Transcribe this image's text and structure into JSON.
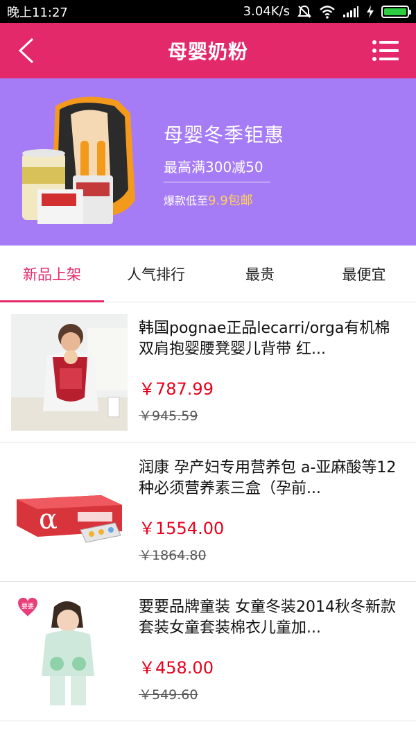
{
  "status_bar": {
    "time": "晚上11:27",
    "network_speed": "3.04K/s"
  },
  "header": {
    "title": "母婴奶粉",
    "back_icon": "chevron-left-icon",
    "menu_icon": "list-menu-icon"
  },
  "banner": {
    "title": "母婴冬季钜惠",
    "subtitle": "最高满300减50",
    "note_prefix": "爆款低至",
    "note_highlight": "9.9包邮",
    "colors": {
      "background": "#a67cf6",
      "highlight": "#ffd05a"
    }
  },
  "tabs": [
    {
      "label": "新品上架",
      "active": true
    },
    {
      "label": "人气排行",
      "active": false
    },
    {
      "label": "最贵",
      "active": false
    },
    {
      "label": "最便宜",
      "active": false
    }
  ],
  "products": [
    {
      "title": "韩国pognae正品lecarri/orga有机棉双肩抱婴腰凳婴儿背带 红...",
      "price": "￥787.99",
      "old_price": "￥945.59"
    },
    {
      "title": "润康 孕产妇专用营养包 a-亚麻酸等12种必须营养素三盒（孕前...",
      "price": "￥1554.00",
      "old_price": "￥1864.80"
    },
    {
      "title": "要要品牌童装 女童冬装2014秋冬新款套装女童套装棉衣儿童加...",
      "price": "￥458.00",
      "old_price": "￥549.60",
      "badge": "要要"
    }
  ],
  "colors": {
    "brand": "#e4296a",
    "price": "#e8001c"
  }
}
